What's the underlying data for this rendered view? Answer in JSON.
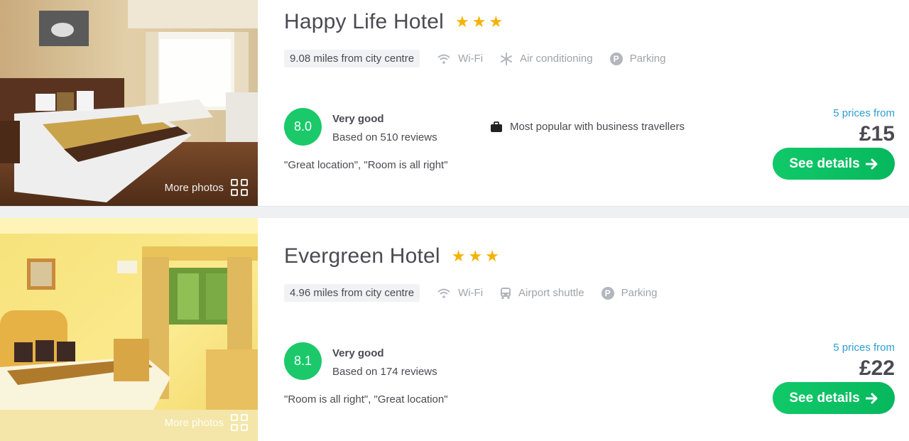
{
  "hotels": [
    {
      "name": "Happy Life Hotel",
      "stars": 3,
      "distance": "9.08 miles from city centre",
      "amenities": [
        "Wi-Fi",
        "Air conditioning",
        "Parking"
      ],
      "score": "8.0",
      "rating_label": "Very good",
      "reviews": "Based on 510 reviews",
      "quote": "\"Great location\", \"Room is all right\"",
      "popular": "Most popular with business travellers",
      "prices_from": "5 prices from",
      "price": "£15",
      "button": "See details",
      "more_photos": "More photos"
    },
    {
      "name": "Evergreen Hotel",
      "stars": 3,
      "distance": "4.96 miles from city centre",
      "amenities": [
        "Wi-Fi",
        "Airport shuttle",
        "Parking"
      ],
      "score": "8.1",
      "rating_label": "Very good",
      "reviews": "Based on 174 reviews",
      "quote": "\"Room is all right\", \"Great location\"",
      "prices_from": "5 prices from",
      "price": "£22",
      "button": "See details",
      "more_photos": "More photos"
    }
  ],
  "colors": {
    "score_green": "#1bc96a",
    "button_green": "#11c969",
    "star_gold": "#f5b301",
    "link_blue": "#2b9fd2",
    "amenity_grey": "#a0a3ab"
  }
}
